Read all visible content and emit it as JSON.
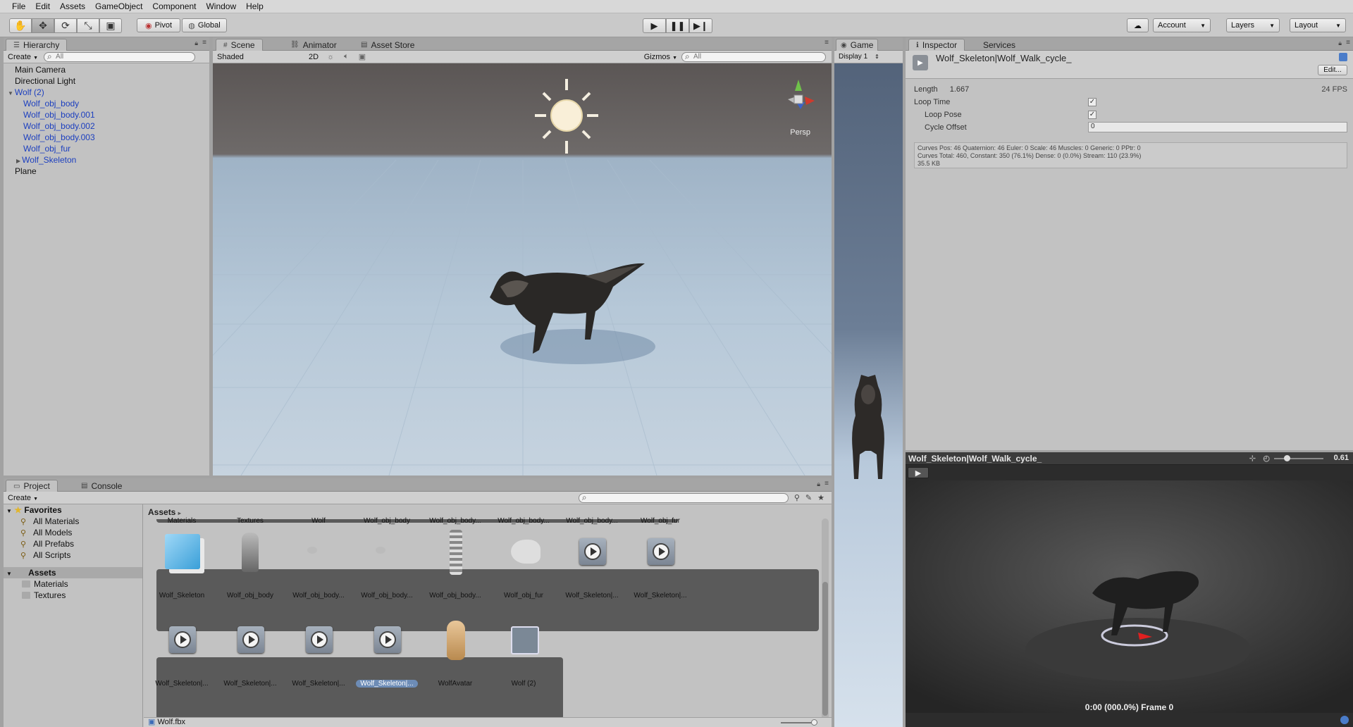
{
  "menu": [
    "File",
    "Edit",
    "Assets",
    "GameObject",
    "Component",
    "Window",
    "Help"
  ],
  "toolbar": {
    "pivot": "Pivot",
    "global": "Global",
    "account": "Account",
    "layers": "Layers",
    "layout": "Layout",
    "tool_icons": [
      "hand-icon",
      "move-icon",
      "rotate-icon",
      "scale-icon",
      "rect-tool-icon"
    ]
  },
  "hierarchy": {
    "tab": "Hierarchy",
    "create": "Create",
    "search_placeholder": "All",
    "items": [
      {
        "label": "Main Camera",
        "indent": 0,
        "blue": false,
        "arrow": ""
      },
      {
        "label": "Directional Light",
        "indent": 0,
        "blue": false,
        "arrow": ""
      },
      {
        "label": "Wolf (2)",
        "indent": 0,
        "blue": true,
        "arrow": "▼"
      },
      {
        "label": "Wolf_obj_body",
        "indent": 1,
        "blue": true,
        "arrow": ""
      },
      {
        "label": "Wolf_obj_body.001",
        "indent": 1,
        "blue": true,
        "arrow": ""
      },
      {
        "label": "Wolf_obj_body.002",
        "indent": 1,
        "blue": true,
        "arrow": ""
      },
      {
        "label": "Wolf_obj_body.003",
        "indent": 1,
        "blue": true,
        "arrow": ""
      },
      {
        "label": "Wolf_obj_fur",
        "indent": 1,
        "blue": true,
        "arrow": ""
      },
      {
        "label": "Wolf_Skeleton",
        "indent": 1,
        "blue": true,
        "arrow": "▶"
      },
      {
        "label": "Plane",
        "indent": 0,
        "blue": false,
        "arrow": ""
      }
    ]
  },
  "scene": {
    "tabs": [
      "Scene",
      "Animator",
      "Asset Store"
    ],
    "shading": "Shaded",
    "mode2d": "2D",
    "gizmos": "Gizmos",
    "search_placeholder": "All",
    "persp": "Persp"
  },
  "game": {
    "tab": "Game",
    "display": "Display 1"
  },
  "inspector": {
    "tabs": [
      "Inspector",
      "Services"
    ],
    "title": "Wolf_Skeleton|Wolf_Walk_cycle_",
    "edit": "Edit...",
    "length_label": "Length",
    "length_value": "1.667",
    "fps": "24 FPS",
    "loop_time": "Loop Time",
    "loop_pose": "Loop Pose",
    "cycle_offset": "Cycle Offset",
    "cycle_offset_value": "0",
    "curves_line1": "Curves Pos: 46 Quaternion: 46 Euler: 0 Scale: 46 Muscles: 0 Generic: 0 PPtr: 0",
    "curves_line2": "Curves Total: 460, Constant: 350 (76.1%) Dense: 0 (0.0%) Stream: 110 (23.9%)",
    "curves_line3": "35.5 KB"
  },
  "preview": {
    "title": "Wolf_Skeleton|Wolf_Walk_cycle_",
    "speed": "0.61",
    "status": "0:00 (000.0%) Frame 0"
  },
  "project": {
    "tabs": [
      "Project",
      "Console"
    ],
    "create": "Create",
    "breadcrumb": "Assets",
    "favorites_label": "Favorites",
    "favorites": [
      "All Materials",
      "All Models",
      "All Prefabs",
      "All Scripts"
    ],
    "assets_label": "Assets",
    "folders": [
      "Materials",
      "Textures"
    ],
    "row0": [
      "Materials",
      "Textures",
      "Wolf",
      "Wolf_obj_body",
      "Wolf_obj_body...",
      "Wolf_obj_body...",
      "Wolf_obj_body...",
      "Wolf_obj_fur"
    ],
    "row1": [
      "Wolf_Skeleton",
      "Wolf_obj_body",
      "Wolf_obj_body...",
      "Wolf_obj_body...",
      "Wolf_obj_body...",
      "Wolf_obj_fur",
      "Wolf_Skeleton|...",
      "Wolf_Skeleton|..."
    ],
    "row2": [
      "Wolf_Skeleton|...",
      "Wolf_Skeleton|...",
      "Wolf_Skeleton|...",
      "Wolf_Skeleton|...",
      "WolfAvatar",
      "Wolf (2)"
    ],
    "footer_file": "Wolf.fbx"
  }
}
